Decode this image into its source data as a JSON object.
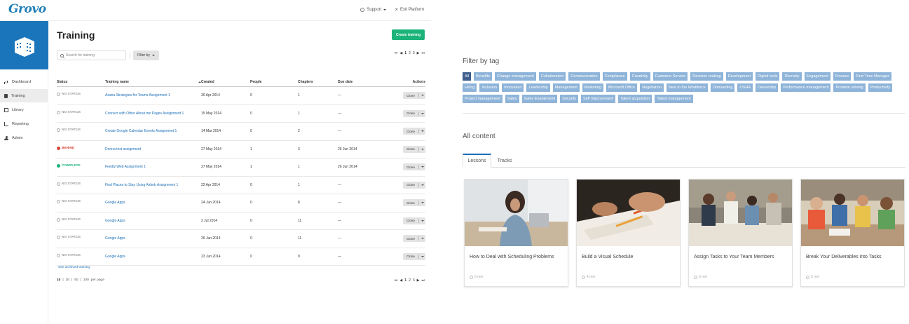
{
  "app": {
    "logo": "Grovo",
    "top_links": {
      "support": "Support",
      "exit": "Exit Platform"
    }
  },
  "sidebar": {
    "items": [
      {
        "label": "Dashboard",
        "icon": "chart-icon"
      },
      {
        "label": "Training",
        "icon": "document-icon",
        "active": true
      },
      {
        "label": "Library",
        "icon": "book-icon"
      },
      {
        "label": "Reporting",
        "icon": "pencil-icon"
      },
      {
        "label": "Admin",
        "icon": "user-icon"
      }
    ]
  },
  "main": {
    "title": "Training",
    "create_button": "Create training",
    "search_placeholder": "Search for training",
    "filter_button": "Filter by",
    "pager": {
      "first": "⏮",
      "prev": "◀",
      "pages": [
        "1",
        "2",
        "3"
      ],
      "current": "1",
      "next": "▶",
      "last": "⏭"
    },
    "columns": {
      "status": "Status",
      "name": "Training name",
      "created": "Created",
      "people": "People",
      "chapters": "Chapters",
      "due": "Due date",
      "actions": "Actions"
    },
    "rows": [
      {
        "status": "NO STATUS",
        "status_type": "none",
        "name": "Asana Strategies for Teams Assignment 1",
        "created": "30 Apr 2014",
        "people": "0",
        "chapters": "1",
        "due": "—",
        "action": "Clone"
      },
      {
        "status": "NO STATUS",
        "status_type": "none",
        "name": "Connect with Other About.me Pages Assignment 1",
        "created": "15 May 2014",
        "people": "0",
        "chapters": "1",
        "due": "—",
        "action": "Clone"
      },
      {
        "status": "NO STATUS",
        "status_type": "none",
        "name": "Create Google Calendar Events Assignment 1",
        "created": "14 Mar 2014",
        "people": "0",
        "chapters": "2",
        "due": "—",
        "action": "Clone"
      },
      {
        "status": "BEHIND",
        "status_type": "behind",
        "name": "Donna test assignment",
        "created": "27 May 2014",
        "people": "1",
        "chapters": "3",
        "due": "26 Jun 2014",
        "action": "Clone"
      },
      {
        "status": "COMPLETE",
        "status_type": "complete",
        "name": "Feedly Web Assignment 1",
        "created": "27 May 2014",
        "people": "1",
        "chapters": "1",
        "due": "26 Jun 2014",
        "action": "Clone"
      },
      {
        "status": "NO STATUS",
        "status_type": "none",
        "name": "Find Places to Stay Using Airbnb Assignment 1",
        "created": "22 Apr 2014",
        "people": "0",
        "chapters": "1",
        "due": "—",
        "action": "Clone"
      },
      {
        "status": "NO STATUS",
        "status_type": "none",
        "name": "Google Apps",
        "created": "24 Jun 2014",
        "people": "0",
        "chapters": "8",
        "due": "—",
        "action": "Clone"
      },
      {
        "status": "NO STATUS",
        "status_type": "none",
        "name": "Google Apps",
        "created": "2 Jul 2014",
        "people": "0",
        "chapters": "11",
        "due": "—",
        "action": "Clone"
      },
      {
        "status": "NO STATUS",
        "status_type": "none",
        "name": "Google Apps",
        "created": "26 Jun 2014",
        "people": "0",
        "chapters": "11",
        "due": "—",
        "action": "Clone"
      },
      {
        "status": "NO STATUS",
        "status_type": "none",
        "name": "Google Apps",
        "created": "23 Jun 2014",
        "people": "0",
        "chapters": "9",
        "due": "—",
        "action": "Clone"
      }
    ],
    "archived_link": "See archived training",
    "per_page": {
      "options": [
        "10",
        "25",
        "50",
        "100"
      ],
      "current": "10",
      "suffix": "per page"
    }
  },
  "library": {
    "filter_title": "Filter by tag",
    "tags": [
      "All",
      "Benefits",
      "Change management",
      "Collaboration",
      "Communication",
      "Compliance",
      "Creativity",
      "Customer Service",
      "Decision making",
      "Development",
      "Digital tools",
      "Diversity",
      "Engagement",
      "Finance",
      "First Time Manager",
      "Hiring",
      "Inclusion",
      "Innovation",
      "Leadership",
      "Management",
      "Marketing",
      "Microsoft Office",
      "Negotiation",
      "New to the Workforce",
      "Onboarding",
      "OSHA",
      "Ownership",
      "Performance management",
      "Problem solving",
      "Productivity",
      "Project management",
      "Sales",
      "Sales Enablement",
      "Security",
      "Self Improvement",
      "Talent acquisition",
      "Talent management"
    ],
    "content_title": "All content",
    "tabs": [
      "Lessons",
      "Tracks"
    ],
    "cards": [
      {
        "title": "How to Deal with Scheduling Problems",
        "meta": "5 min"
      },
      {
        "title": "Build a Visual Schedule",
        "meta": "4 min"
      },
      {
        "title": "Assign Tasks to Your Team Members",
        "meta": "5 min"
      },
      {
        "title": "Break Your Deliverables into Tasks",
        "meta": "5 min"
      }
    ]
  },
  "colors": {
    "brand_blue": "#1b75bb",
    "create_green": "#1ab37a",
    "behind_red": "#d7443a",
    "tag_blue": "#8eb4d9",
    "tag_active": "#3f5e8c",
    "link_blue": "#1d6fb8"
  }
}
